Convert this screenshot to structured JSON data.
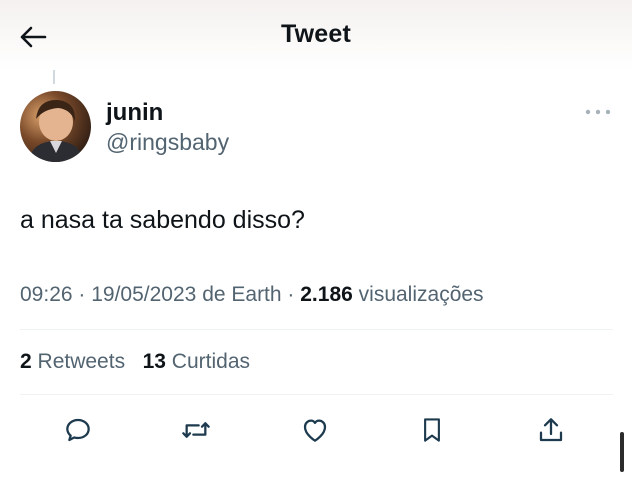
{
  "header": {
    "title": "Tweet"
  },
  "tweet": {
    "author": {
      "display_name": "junin",
      "handle": "@ringsbaby"
    },
    "text": "a nasa ta sabendo disso?",
    "meta": {
      "time": "09:26",
      "date": "19/05/2023",
      "source": "de Earth",
      "views_count": "2.186",
      "views_label": "visualizações"
    },
    "stats": {
      "retweets_count": "2",
      "retweets_label": "Retweets",
      "likes_count": "13",
      "likes_label": "Curtidas"
    }
  },
  "icons": [
    "back-arrow-icon",
    "more-icon",
    "reply-icon",
    "retweet-icon",
    "like-icon",
    "bookmark-icon",
    "share-icon"
  ],
  "colors": {
    "text": "#0f1419",
    "secondary": "#536471",
    "divider": "#eff3f4"
  }
}
